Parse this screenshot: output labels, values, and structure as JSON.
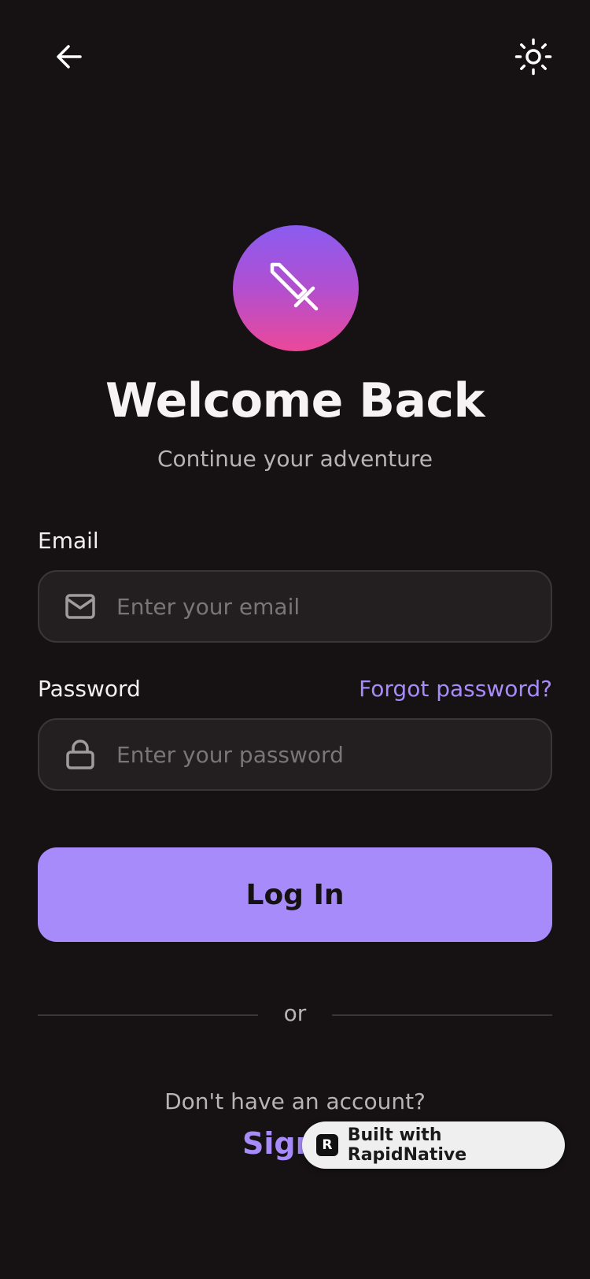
{
  "header": {
    "back_icon": "arrow-left-icon",
    "theme_icon": "sun-icon"
  },
  "logo": {
    "icon": "sword-icon",
    "gradient_top": "#8a5cf0",
    "gradient_bottom": "#ec4899"
  },
  "title": "Welcome Back",
  "subtitle": "Continue your adventure",
  "email": {
    "label": "Email",
    "placeholder": "Enter your email",
    "value": "",
    "icon": "mail-icon"
  },
  "password": {
    "label": "Password",
    "placeholder": "Enter your password",
    "value": "",
    "icon": "lock-icon",
    "forgot_label": "Forgot password?"
  },
  "login_button": "Log In",
  "divider_text": "or",
  "signup": {
    "prompt": "Don't have an account?",
    "link_label": "Sign"
  },
  "badge": {
    "logo_glyph": "R",
    "text": "Built with RapidNative"
  },
  "colors": {
    "background": "#161213",
    "accent": "#a78bfa",
    "field_bg": "#231f20",
    "field_border": "#3b3536"
  }
}
